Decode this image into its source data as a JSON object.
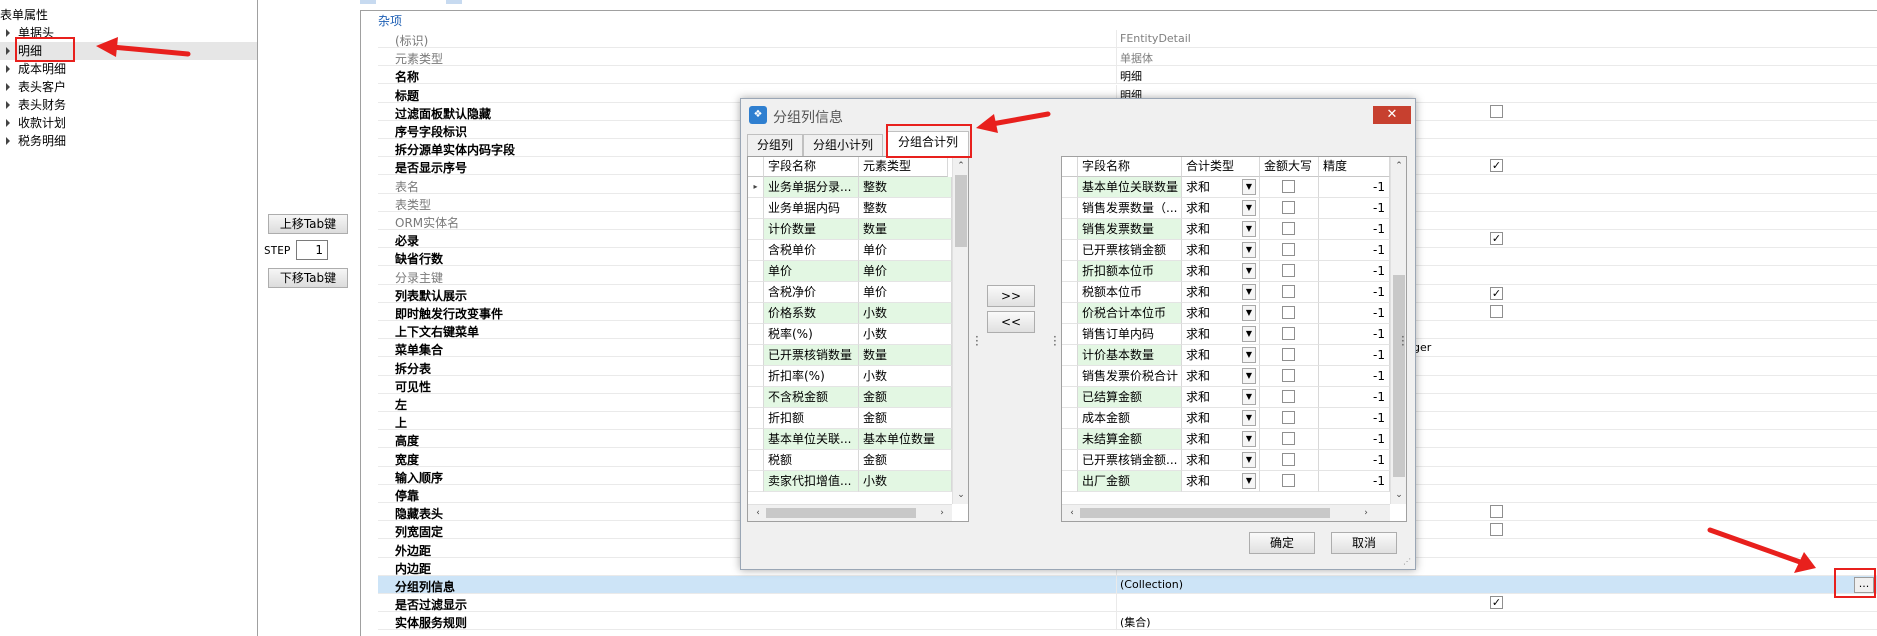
{
  "tree": {
    "title": "表单属性",
    "items": [
      {
        "label": "单据头",
        "selected": false
      },
      {
        "label": "明细",
        "selected": true
      },
      {
        "label": "成本明细",
        "selected": false
      },
      {
        "label": "表头客户",
        "selected": false
      },
      {
        "label": "表头财务",
        "selected": false
      },
      {
        "label": "收款计划",
        "selected": false
      },
      {
        "label": "税务明细",
        "selected": false
      }
    ]
  },
  "middle": {
    "move_up_label": "上移Tab键",
    "step_label": "STEP",
    "step_value": "1",
    "move_down_label": "下移Tab键"
  },
  "property_grid": {
    "category": "杂项",
    "rows": [
      {
        "name": "(标识)",
        "value": "FEntityDetail",
        "gray": true
      },
      {
        "name": "元素类型",
        "value": "单据体",
        "gray": true
      },
      {
        "name": "名称",
        "value": "明细"
      },
      {
        "name": "标题",
        "value": "明细"
      },
      {
        "name": "过滤面板默认隐藏",
        "value": "",
        "checkbox": false
      },
      {
        "name": "序号字段标识",
        "value": ""
      },
      {
        "name": "拆分源单实体内码字段",
        "value": ""
      },
      {
        "name": "是否显示序号",
        "value": "",
        "checkbox": true
      },
      {
        "name": "表名",
        "value": "",
        "gray": true
      },
      {
        "name": "表类型",
        "value": "",
        "gray": true
      },
      {
        "name": "ORM实体名",
        "value": "",
        "gray": true
      },
      {
        "name": "必录",
        "value": "",
        "checkbox": true
      },
      {
        "name": "缺省行数",
        "value": ""
      },
      {
        "name": "分录主键",
        "value": "",
        "gray": true
      },
      {
        "name": "列表默认展示",
        "value": "",
        "checkbox": true
      },
      {
        "name": "即时触发行改变事件",
        "value": "",
        "checkbox": false
      },
      {
        "name": "上下文右键菜单",
        "value": ""
      },
      {
        "name": "菜单集合",
        "value": "ger"
      },
      {
        "name": "拆分表",
        "value": ""
      },
      {
        "name": "可见性",
        "value": ""
      },
      {
        "name": "左",
        "value": ""
      },
      {
        "name": "上",
        "value": ""
      },
      {
        "name": "高度",
        "value": ""
      },
      {
        "name": "宽度",
        "value": ""
      },
      {
        "name": "输入顺序",
        "value": ""
      },
      {
        "name": "停靠",
        "value": ""
      },
      {
        "name": "隐藏表头",
        "value": "",
        "checkbox": false
      },
      {
        "name": "列宽固定",
        "value": "",
        "checkbox": false
      },
      {
        "name": "外边距",
        "value": ""
      },
      {
        "name": "内边距",
        "value": ""
      },
      {
        "name": "分组列信息",
        "value": "(Collection)",
        "selected": true
      },
      {
        "name": "是否过滤显示",
        "value": "",
        "checkbox": true
      },
      {
        "name": "实体服务规则",
        "value": "(集合)"
      }
    ],
    "ellipsis_label": "..."
  },
  "dialog": {
    "title": "分组列信息",
    "close_label": "✕",
    "tabs": [
      {
        "label": "分组列",
        "active": false
      },
      {
        "label": "分组小计列",
        "active": false
      },
      {
        "label": "分组合计列",
        "active": true
      }
    ],
    "left_grid": {
      "columns": [
        "字段名称",
        "元素类型"
      ],
      "rows": [
        [
          "业务单据分录...",
          "整数"
        ],
        [
          "业务单据内码",
          "整数"
        ],
        [
          "计价数量",
          "数量"
        ],
        [
          "含税单价",
          "单价"
        ],
        [
          "单价",
          "单价"
        ],
        [
          "含税净价",
          "单价"
        ],
        [
          "价格系数",
          "小数"
        ],
        [
          "税率(%)",
          "小数"
        ],
        [
          "已开票核销数量",
          "数量"
        ],
        [
          "折扣率(%)",
          "小数"
        ],
        [
          "不含税金额",
          "金额"
        ],
        [
          "折扣额",
          "金额"
        ],
        [
          "基本单位关联...",
          "基本单位数量"
        ],
        [
          "税额",
          "金额"
        ],
        [
          "卖家代扣增值...",
          "小数"
        ]
      ]
    },
    "add_label": ">>",
    "remove_label": "<<",
    "right_grid": {
      "columns": [
        "字段名称",
        "合计类型",
        "金额大写",
        "精度"
      ],
      "rows": [
        [
          "基本单位关联数量",
          "求和",
          "-1"
        ],
        [
          "销售发票数量（...",
          "求和",
          "-1"
        ],
        [
          "销售发票数量",
          "求和",
          "-1"
        ],
        [
          "已开票核销金额",
          "求和",
          "-1"
        ],
        [
          "折扣额本位币",
          "求和",
          "-1"
        ],
        [
          "税额本位币",
          "求和",
          "-1"
        ],
        [
          "价税合计本位币",
          "求和",
          "-1"
        ],
        [
          "销售订单内码",
          "求和",
          "-1"
        ],
        [
          "计价基本数量",
          "求和",
          "-1"
        ],
        [
          "销售发票价税合计",
          "求和",
          "-1"
        ],
        [
          "已结算金额",
          "求和",
          "-1"
        ],
        [
          "成本金额",
          "求和",
          "-1"
        ],
        [
          "未结算金额",
          "求和",
          "-1"
        ],
        [
          "已开票核销金额...",
          "求和",
          "-1"
        ],
        [
          "出厂金额",
          "求和",
          "-1"
        ]
      ]
    },
    "ok_label": "确定",
    "cancel_label": "取消"
  },
  "colors": {
    "annotation_red": "#e8201d",
    "selected_row": "#cde4f7",
    "green_row": "#e3f7e3",
    "close_button": "#c7402f"
  }
}
